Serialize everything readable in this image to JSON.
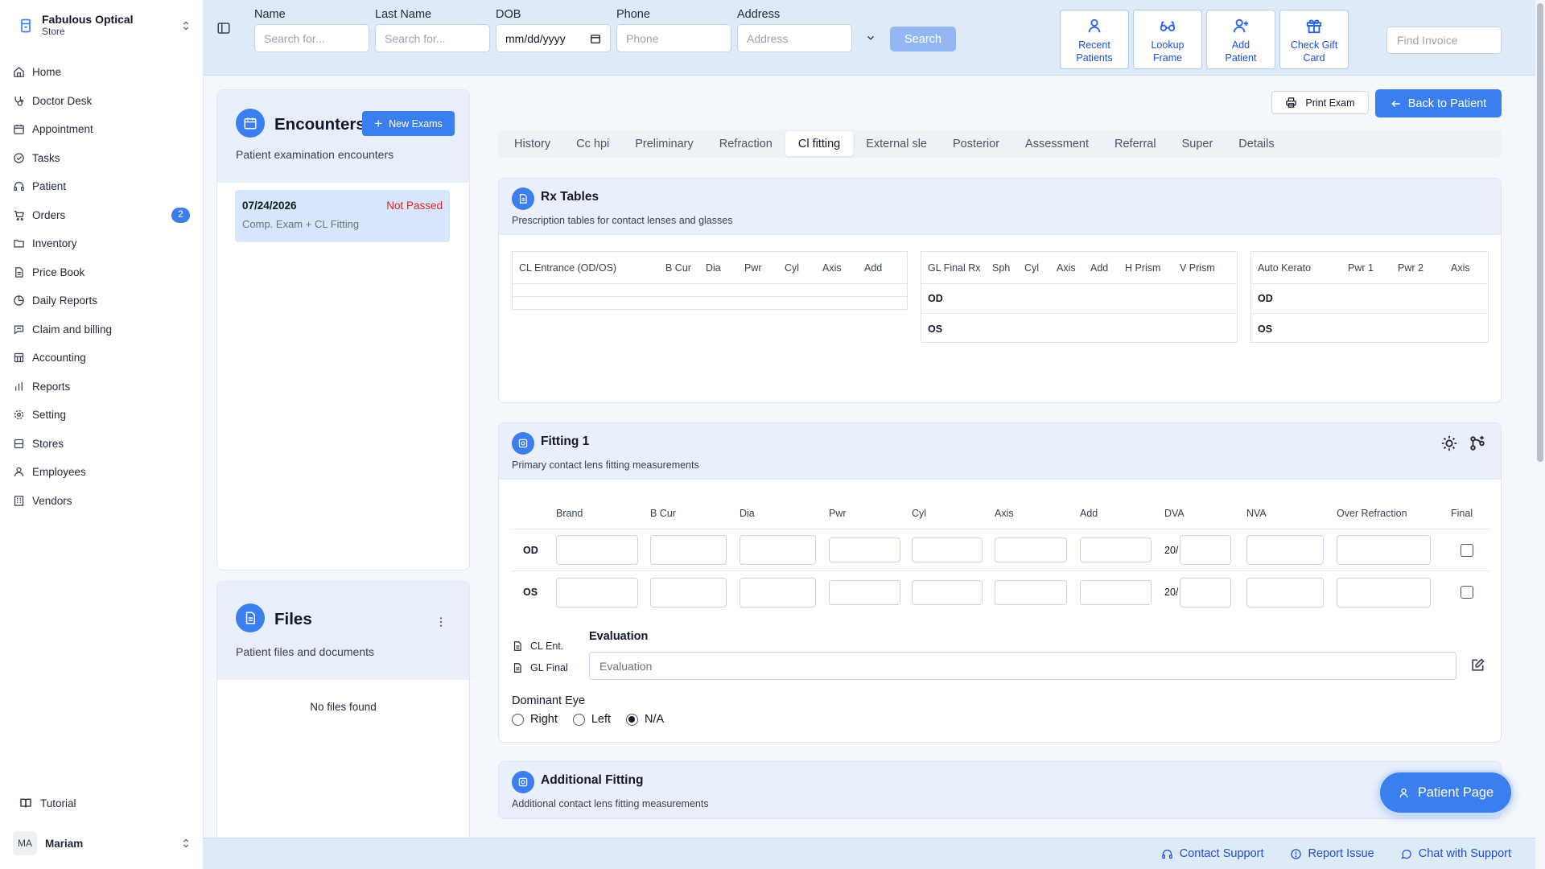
{
  "store": {
    "name": "Fabulous Optical",
    "type": "Store"
  },
  "nav": [
    {
      "label": "Home",
      "icon": "home-icon"
    },
    {
      "label": "Doctor Desk",
      "icon": "stethoscope-icon"
    },
    {
      "label": "Appointment",
      "icon": "calendar-icon"
    },
    {
      "label": "Tasks",
      "icon": "check-circle-icon"
    },
    {
      "label": "Patient",
      "icon": "headset-icon"
    },
    {
      "label": "Orders",
      "icon": "cart-icon",
      "badge": "2"
    },
    {
      "label": "Inventory",
      "icon": "folder-icon"
    },
    {
      "label": "Price Book",
      "icon": "document-icon"
    },
    {
      "label": "Daily Reports",
      "icon": "report-icon"
    },
    {
      "label": "Claim and billing",
      "icon": "message-icon"
    },
    {
      "label": "Accounting",
      "icon": "bank-icon"
    },
    {
      "label": "Reports",
      "icon": "bar-chart-icon"
    },
    {
      "label": "Setting",
      "icon": "gear-icon"
    },
    {
      "label": "Stores",
      "icon": "store-icon"
    },
    {
      "label": "Employees",
      "icon": "user-icon"
    },
    {
      "label": "Vendors",
      "icon": "building-icon"
    }
  ],
  "tutorial": "Tutorial",
  "user": {
    "initials": "MA",
    "name": "Mariam"
  },
  "search": {
    "name_label": "Name",
    "name_placeholder": "Search for...",
    "last_label": "Last Name",
    "last_placeholder": "Search for...",
    "dob_label": "DOB",
    "dob_value": "mm/dd/yyyy",
    "phone_label": "Phone",
    "phone_placeholder": "Phone",
    "address_label": "Address",
    "address_placeholder": "Address",
    "button": "Search"
  },
  "top_buttons": {
    "recent": [
      "Recent",
      "Patients"
    ],
    "lookup": [
      "Lookup",
      "Frame"
    ],
    "add": [
      "Add",
      "Patient"
    ],
    "gift": [
      "Check Gift",
      "Card"
    ]
  },
  "find_invoice": "Find Invoice",
  "encounters": {
    "title": "Encounters",
    "subtitle": "Patient examination encounters",
    "new_button": "New Exams",
    "items": [
      {
        "date": "07/24/2026",
        "status": "Not Passed",
        "desc": "Comp. Exam + CL Fitting"
      }
    ]
  },
  "files": {
    "title": "Files",
    "subtitle": "Patient files and documents",
    "empty": "No files found"
  },
  "actions": {
    "print": "Print Exam",
    "back": "Back to Patient"
  },
  "tabs": [
    "History",
    "Cc hpi",
    "Preliminary",
    "Refraction",
    "Cl fitting",
    "External sle",
    "Posterior",
    "Assessment",
    "Referral",
    "Super",
    "Details"
  ],
  "active_tab": "Cl fitting",
  "rx": {
    "title": "Rx Tables",
    "subtitle": "Prescription tables for contact lenses and glasses",
    "cl_headers": [
      "CL Entrance (OD/OS)",
      "B Cur",
      "Dia",
      "Pwr",
      "Cyl",
      "Axis",
      "Add"
    ],
    "gl_headers": [
      "GL Final Rx",
      "Sph",
      "Cyl",
      "Axis",
      "Add",
      "H Prism",
      "V Prism"
    ],
    "gl_rows": [
      "OD",
      "OS"
    ],
    "ak_headers": [
      "Auto Kerato",
      "Pwr 1",
      "Pwr 2",
      "Axis"
    ],
    "ak_rows": [
      "OD",
      "OS"
    ]
  },
  "fitting": {
    "title": "Fitting 1",
    "subtitle": "Primary contact lens fitting measurements",
    "headers": [
      "Brand",
      "B Cur",
      "Dia",
      "Pwr",
      "Cyl",
      "Axis",
      "Add",
      "DVA",
      "NVA",
      "Over Refraction",
      "Final"
    ],
    "rows": [
      "OD",
      "OS"
    ],
    "dva_prefix": "20/",
    "cl_ent": "CL Ent.",
    "gl_final": "GL Final",
    "evaluation_label": "Evaluation",
    "evaluation_placeholder": "Evaluation",
    "dominant_label": "Dominant Eye",
    "dominant_options": [
      "Right",
      "Left",
      "N/A"
    ],
    "dominant_selected": "N/A"
  },
  "additional": {
    "title": "Additional Fitting",
    "subtitle": "Additional contact lens fitting measurements"
  },
  "footer": {
    "contact": "Contact Support",
    "report": "Report Issue",
    "chat": "Chat with Support"
  },
  "patient_page": "Patient Page",
  "colors": {
    "accent": "#3b7ef0",
    "status_fail": "#dc2626",
    "topbar": "#dfeaf9"
  }
}
